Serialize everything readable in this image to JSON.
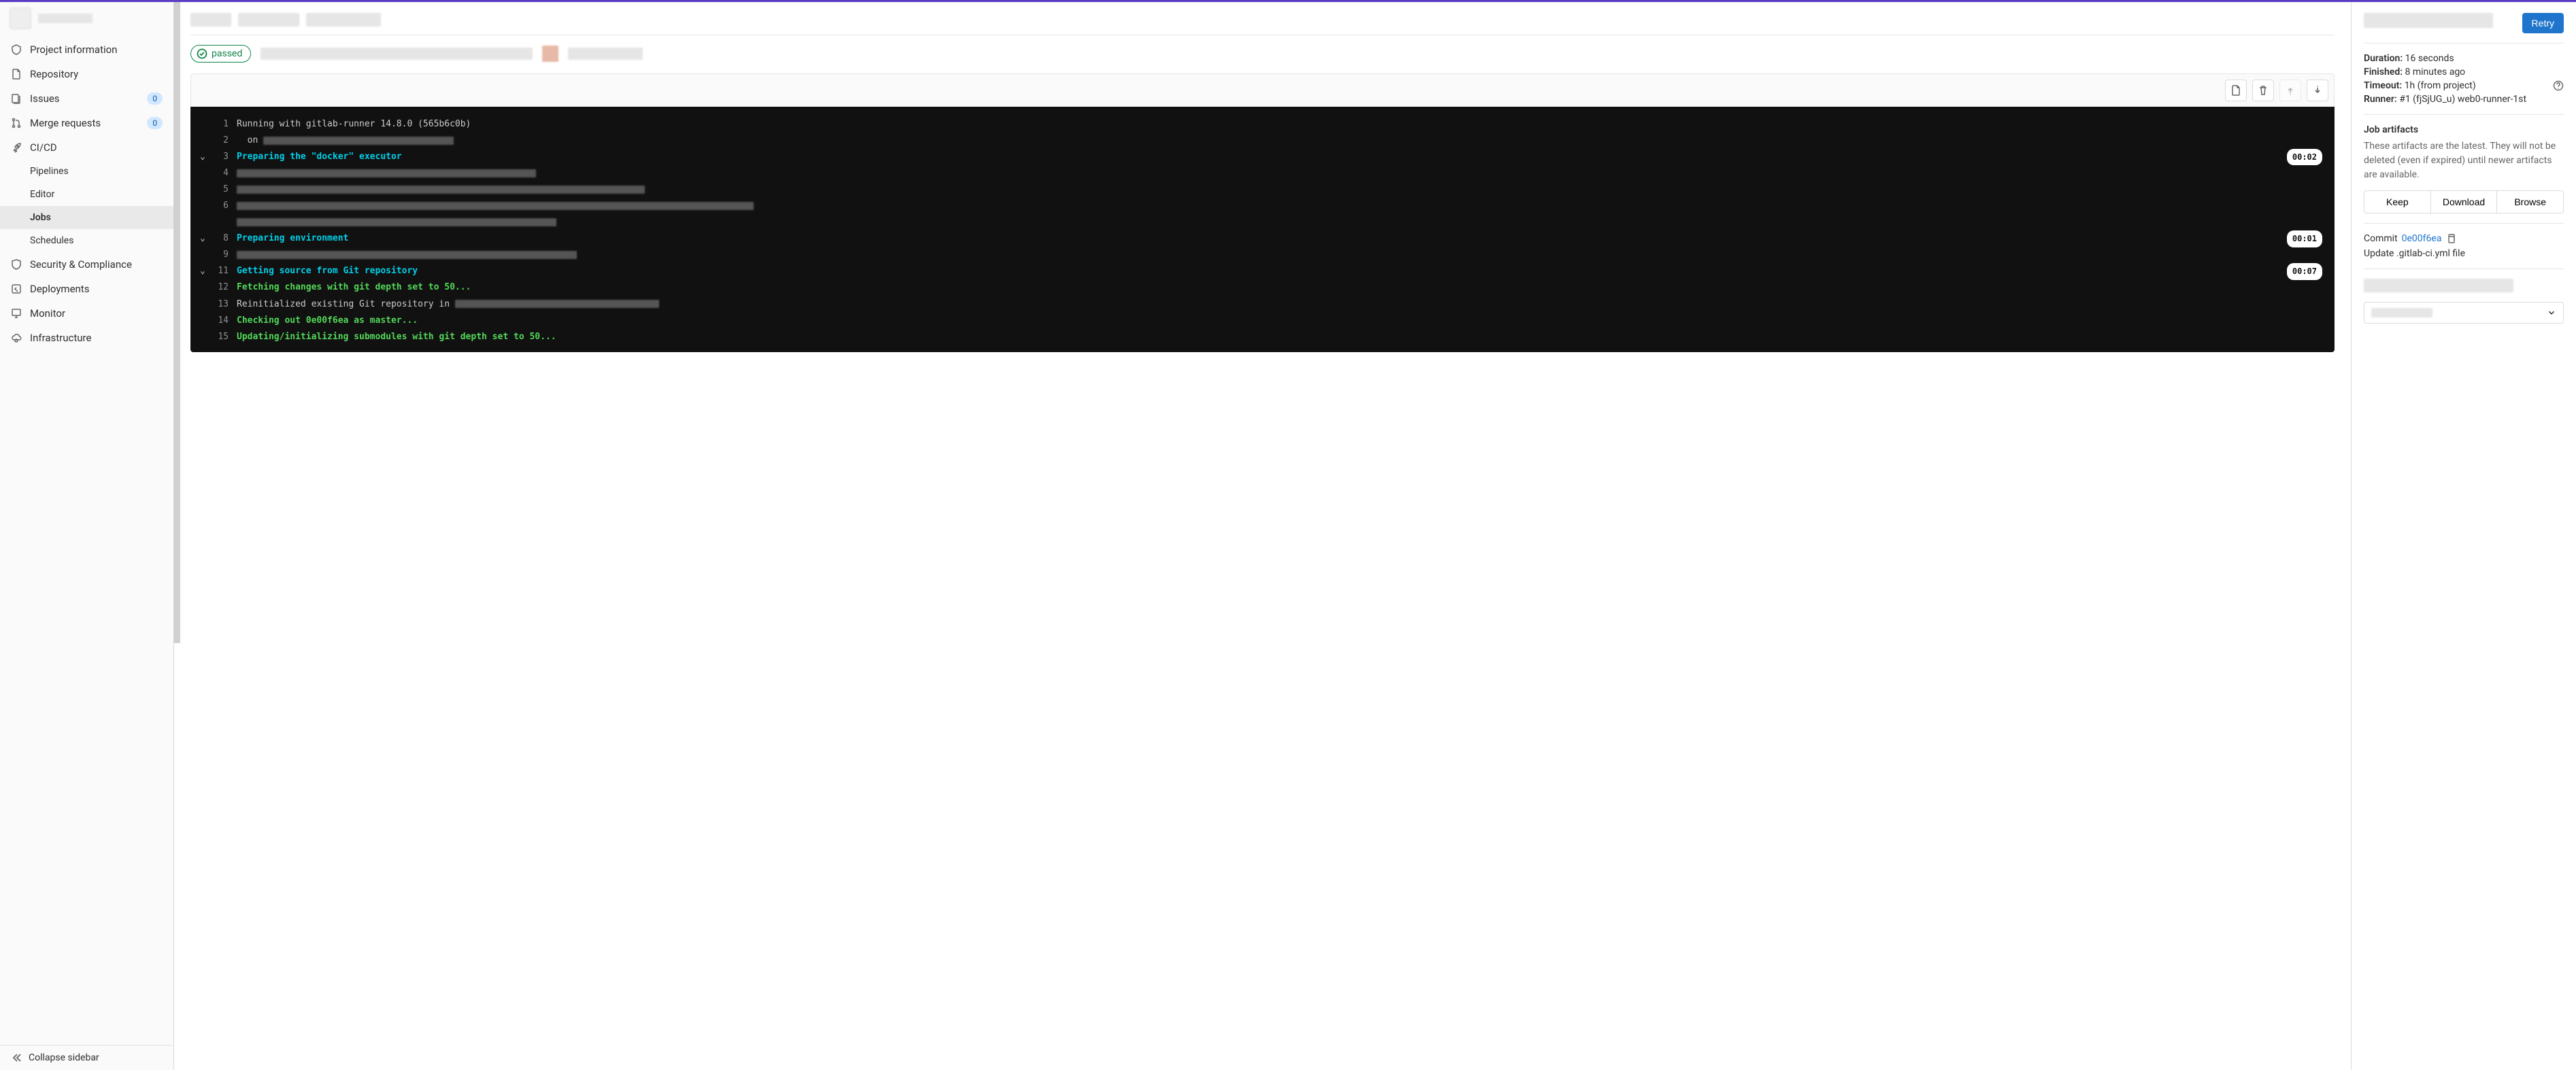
{
  "sidebar": {
    "items": [
      {
        "label": "Project information",
        "badge": null
      },
      {
        "label": "Repository",
        "badge": null
      },
      {
        "label": "Issues",
        "badge": "0"
      },
      {
        "label": "Merge requests",
        "badge": "0"
      },
      {
        "label": "CI/CD",
        "badge": null
      },
      {
        "label": "Security & Compliance",
        "badge": null
      },
      {
        "label": "Deployments",
        "badge": null
      },
      {
        "label": "Monitor",
        "badge": null
      },
      {
        "label": "Infrastructure",
        "badge": null
      }
    ],
    "cicd_sub": [
      "Pipelines",
      "Editor",
      "Jobs",
      "Schedules"
    ],
    "collapse_label": "Collapse sidebar"
  },
  "status": {
    "label": "passed"
  },
  "log_toolbar": {
    "raw": "Show raw",
    "erase": "Erase job log",
    "top": "Scroll to top",
    "bottom": "Scroll to bottom"
  },
  "log": [
    {
      "n": 1,
      "text": "Running with gitlab-runner 14.8.0 (565b6c0b)",
      "cls": ""
    },
    {
      "n": 2,
      "text": "  on ",
      "cls": "",
      "redact_after": 280
    },
    {
      "n": 3,
      "text": "Preparing the \"docker\" executor",
      "cls": "cyan",
      "fold": true,
      "dur": "00:02"
    },
    {
      "n": 4,
      "text": "",
      "cls": "",
      "redact_full": 440
    },
    {
      "n": 5,
      "text": "",
      "cls": "",
      "redact_full": 600
    },
    {
      "n": 6,
      "text": "",
      "cls": "",
      "redact_full": 760
    },
    {
      "n": "",
      "text": "",
      "cls": "",
      "redact_full": 470
    },
    {
      "n": 8,
      "text": "Preparing environment",
      "cls": "cyan",
      "fold": true,
      "dur": "00:01"
    },
    {
      "n": 9,
      "text": "",
      "cls": "",
      "redact_full": 500
    },
    {
      "n": 11,
      "text": "Getting source from Git repository",
      "cls": "cyan",
      "fold": true,
      "dur": "00:07"
    },
    {
      "n": 12,
      "text": "Fetching changes with git depth set to 50...",
      "cls": "green"
    },
    {
      "n": 13,
      "text": "Reinitialized existing Git repository in ",
      "cls": "",
      "redact_after": 300
    },
    {
      "n": 14,
      "text": "Checking out 0e00f6ea as master...",
      "cls": "green"
    },
    {
      "n": 15,
      "text": "Updating/initializing submodules with git depth set to 50...",
      "cls": "green"
    }
  ],
  "right": {
    "retry": "Retry",
    "duration_k": "Duration:",
    "duration_v": "16 seconds",
    "finished_k": "Finished:",
    "finished_v": "8 minutes ago",
    "timeout_k": "Timeout:",
    "timeout_v": "1h (from project)",
    "runner_k": "Runner:",
    "runner_v": "#1 (fjSjUG_u) web0-runner-1st",
    "artifacts_title": "Job artifacts",
    "artifacts_desc": "These artifacts are the latest. They will not be deleted (even if expired) until newer artifacts are available.",
    "keep": "Keep",
    "download": "Download",
    "browse": "Browse",
    "commit_k": "Commit",
    "commit_sha": "0e00f6ea",
    "commit_msg": "Update .gitlab-ci.yml file"
  }
}
